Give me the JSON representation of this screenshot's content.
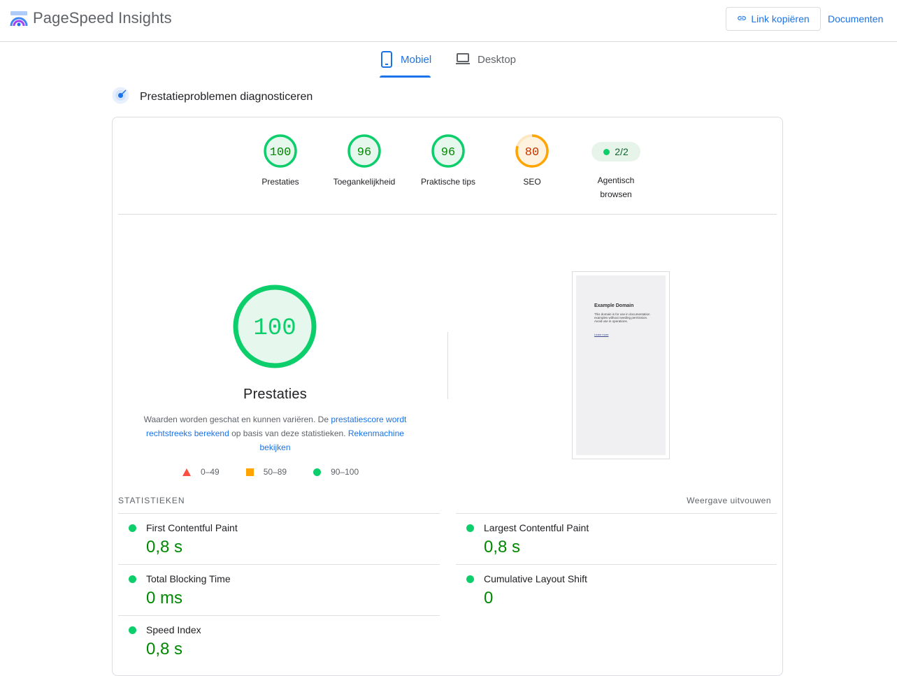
{
  "header": {
    "brand": "PageSpeed Insights",
    "copy_link": "Link kopiëren",
    "docs": "Documenten"
  },
  "tabs": [
    {
      "label": "Mobiel",
      "active": true
    },
    {
      "label": "Desktop",
      "active": false
    }
  ],
  "section_title": "Prestatieproblemen diagnosticeren",
  "categories": [
    {
      "score": "100",
      "label": "Prestaties",
      "status": "pass"
    },
    {
      "score": "96",
      "label": "Toegankelijkheid",
      "status": "pass"
    },
    {
      "score": "96",
      "label": "Praktische tips",
      "status": "pass"
    },
    {
      "score": "80",
      "label": "SEO",
      "status": "average"
    }
  ],
  "agentic": {
    "value": "2/2",
    "label_line1": "Agentisch",
    "label_line2": "browsen"
  },
  "main_score": {
    "score": "100",
    "label": "Prestaties",
    "desc_prefix": "Waarden worden geschat en kunnen variëren. De ",
    "desc_link1": "prestatiescore wordt rechtstreeks berekend",
    "desc_middle": " op basis van deze statistieken. ",
    "desc_link2": "Rekenmachine bekijken"
  },
  "legend": [
    {
      "range": "0–49",
      "color": "#ff4e42"
    },
    {
      "range": "50–89",
      "color": "#ffa400"
    },
    {
      "range": "90–100",
      "color": "#0cce6b"
    }
  ],
  "screenshot": {
    "title": "Example Domain",
    "body": "This domain is for use in documentation examples without needing permission. Avoid use in operations.",
    "link": "Learn more"
  },
  "stats": {
    "heading": "STATISTIEKEN",
    "expand": "Weergave uitvouwen",
    "metrics": [
      {
        "name": "First Contentful Paint",
        "value": "0,8 s"
      },
      {
        "name": "Largest Contentful Paint",
        "value": "0,8 s"
      },
      {
        "name": "Total Blocking Time",
        "value": "0 ms"
      },
      {
        "name": "Cumulative Layout Shift",
        "value": "0"
      },
      {
        "name": "Speed Index",
        "value": "0,8 s"
      }
    ]
  },
  "colors": {
    "pass": "#0cce6b",
    "average": "#ffa400",
    "accent": "#1a73e8"
  }
}
